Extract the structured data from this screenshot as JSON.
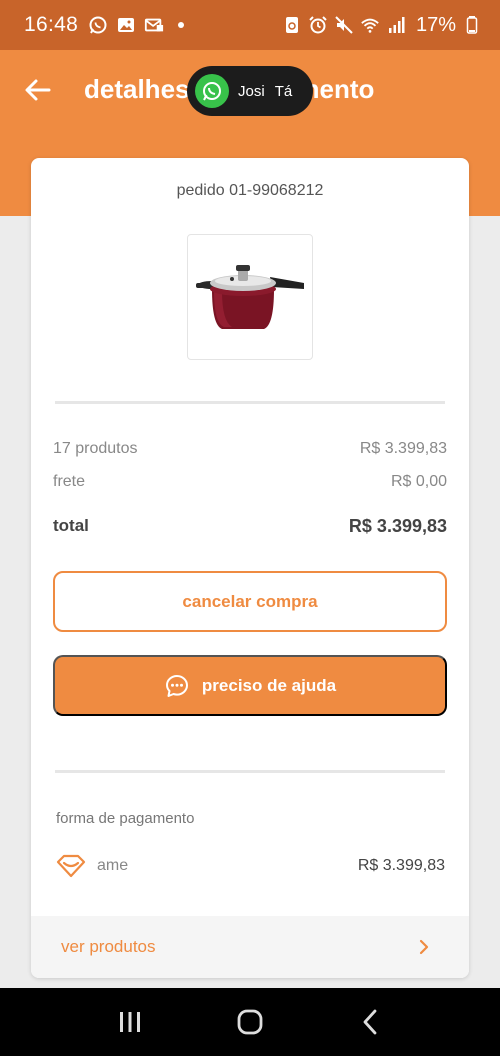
{
  "status_bar": {
    "time": "16:48",
    "battery": "17%",
    "icons": [
      "whatsapp-icon",
      "gallery-icon",
      "email-icon",
      "dot-icon",
      "recycle-icon",
      "alarm-icon",
      "mute-icon",
      "wifi-icon",
      "signal-icon",
      "battery-icon"
    ]
  },
  "header": {
    "title": "detalhes do pagamento",
    "back_icon": "arrow-left-icon",
    "background": "#ef8b41"
  },
  "chat_head": {
    "name": "Josi",
    "message": "Tá",
    "icon": "whatsapp-icon"
  },
  "order": {
    "number_label": "pedido 01-99068212",
    "product_image": "pressure-cooker-image"
  },
  "summary": {
    "products_label": "17 produtos",
    "products_value": "R$ 3.399,83",
    "shipping_label": "frete",
    "shipping_value": "R$ 0,00",
    "total_label": "total",
    "total_value": "R$ 3.399,83"
  },
  "actions": {
    "cancel_label": "cancelar compra",
    "help_label": "preciso de ajuda",
    "help_icon": "chat-bubble-icon"
  },
  "payment": {
    "section_label": "forma de pagamento",
    "method": "ame",
    "method_icon": "ame-heart-icon",
    "amount": "R$ 3.399,83"
  },
  "footer_link": {
    "label": "ver produtos",
    "icon": "chevron-right-icon"
  },
  "nav": {
    "icons": [
      "recents-icon",
      "home-icon",
      "back-icon"
    ]
  },
  "colors": {
    "accent": "#ef8b41",
    "status_bar": "#c8642a"
  }
}
